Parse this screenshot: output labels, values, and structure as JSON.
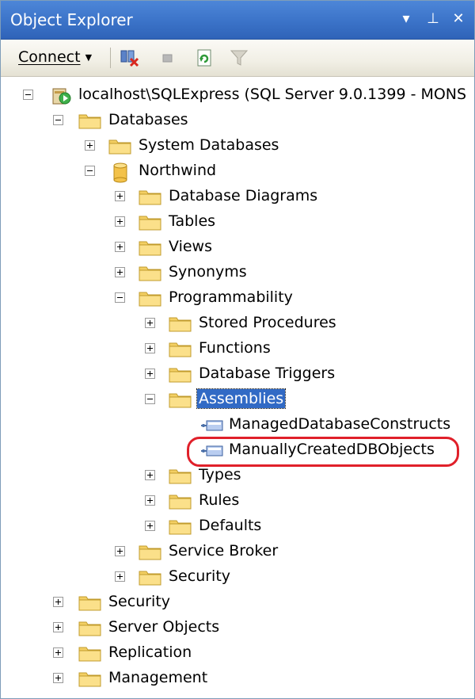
{
  "window": {
    "title": "Object Explorer",
    "buttons": {
      "dropdown": "▾",
      "pin": "⊥",
      "close": "✕"
    }
  },
  "toolbar": {
    "connect_label": "Connect",
    "connect_arrow": "▼",
    "icons": [
      "disconnect-icon",
      "stop-icon",
      "refresh-icon",
      "filter-icon"
    ]
  },
  "tree": {
    "server": "localhost\\SQLExpress (SQL Server 9.0.1399 - MONS",
    "databases": "Databases",
    "system_databases": "System Databases",
    "northwind": "Northwind",
    "database_diagrams": "Database Diagrams",
    "tables": "Tables",
    "views": "Views",
    "synonyms": "Synonyms",
    "programmability": "Programmability",
    "stored_procedures": "Stored Procedures",
    "functions": "Functions",
    "database_triggers": "Database Triggers",
    "assemblies": "Assemblies",
    "assembly_1": "ManagedDatabaseConstructs",
    "assembly_2": "ManuallyCreatedDBObjects",
    "types": "Types",
    "rules": "Rules",
    "defaults": "Defaults",
    "service_broker": "Service Broker",
    "db_security": "Security",
    "security": "Security",
    "server_objects": "Server Objects",
    "replication": "Replication",
    "management": "Management"
  },
  "colors": {
    "title_bar": "#3b73c8",
    "selection": "#316ac5",
    "highlight_ring": "#e0202a",
    "folder": "#f3cf63"
  }
}
